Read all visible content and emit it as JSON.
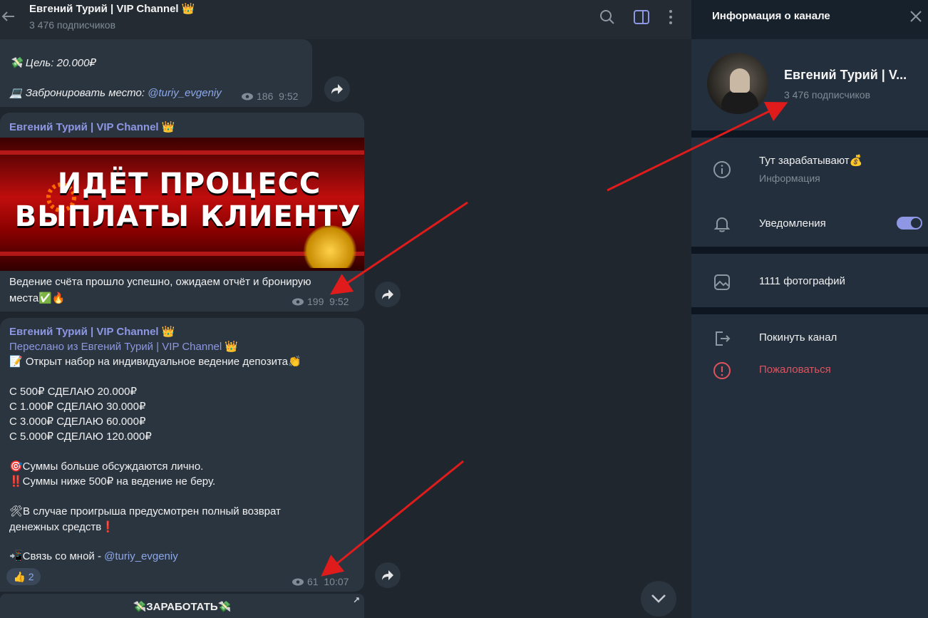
{
  "header": {
    "title": "Евгений Турий | VIP Channel 👑",
    "subscribers": "3 476 подписчиков"
  },
  "post1": {
    "goal": "💸 Цель: 20.000₽",
    "booking_prefix": "💻 Забронировать место: ",
    "booking_link": "@turiy_evgeniy",
    "views": "186",
    "time": "9:52"
  },
  "post2": {
    "sender": "Евгений Турий | VIP Channel 👑",
    "image_line1": "ИДЁТ ПРОЦЕСС",
    "image_line2": "ВЫПЛАТЫ КЛИЕНТУ",
    "text_line1": "Ведение счёта прошло успешно, ожидаем отчёт и бронирую",
    "text_line2": "места✅🔥",
    "views": "199",
    "time": "9:52"
  },
  "post3": {
    "sender": "Евгений Турий | VIP Channel 👑",
    "forwarded": "Переслано из Евгений Турий | VIP Channel 👑",
    "lines": [
      "📝 Открыт набор на индивидуальное ведение депозита👏",
      "С 500₽ СДЕЛАЮ 20.000₽",
      "С 1.000₽ СДЕЛАЮ 30.000₽",
      "С 3.000₽ СДЕЛАЮ 60.000₽",
      "С 5.000₽ СДЕЛАЮ 120.000₽",
      "🎯Суммы больше обсуждаются лично.",
      "‼️Суммы ниже 500₽ на ведение не беру.",
      "🛠В случае проигрыша предусмотрен полный возврат",
      "денежных средств❗️"
    ],
    "contact_prefix": "📲Связь со мной - ",
    "contact_link": "@turiy_evgeniy",
    "reaction": "👍 2",
    "views": "61",
    "time": "10:07"
  },
  "inline_button": "💸ЗАРАБОТАТЬ💸",
  "info_panel": {
    "title": "Информация о канале",
    "name": "Евгений Турий | V...",
    "subscribers": "3 476 подписчиков",
    "about": "Тут зарабатывают💰",
    "about_label": "Информация",
    "notifications": "Уведомления",
    "photos": "1111 фотографий",
    "leave": "Покинуть канал",
    "report": "Пожаловаться"
  },
  "colors": {
    "accent": "#8d97e3",
    "link": "#8ca8ea",
    "danger": "#e0525d",
    "arrow": "#e01b1b"
  }
}
